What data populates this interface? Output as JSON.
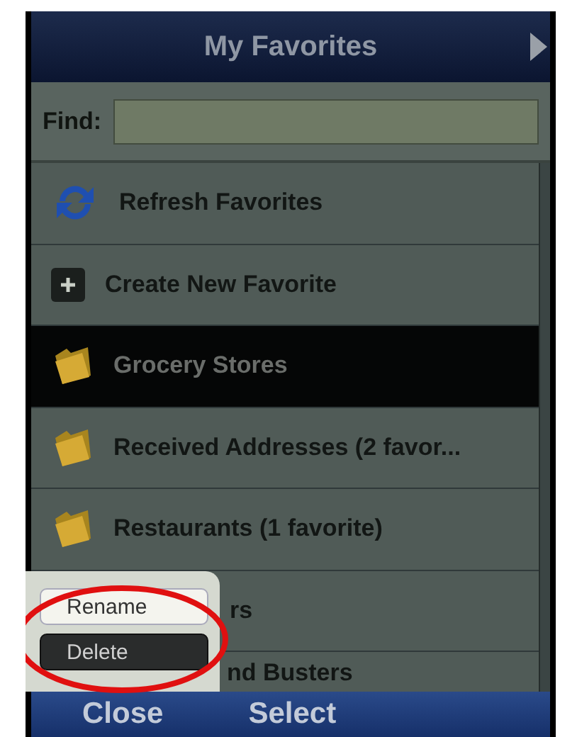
{
  "window": {
    "title": "My Favorites"
  },
  "find": {
    "label": "Find:"
  },
  "list": [
    {
      "kind": "refresh",
      "label": "Refresh Favorites",
      "selected": false
    },
    {
      "kind": "create",
      "label": "Create New Favorite",
      "selected": false
    },
    {
      "kind": "folder",
      "label": "Grocery Stores",
      "selected": true
    },
    {
      "kind": "folder",
      "label": "Received Addresses (2 favor...",
      "selected": false
    },
    {
      "kind": "folder",
      "label": "Restaurants (1 favorite)",
      "selected": false
    },
    {
      "kind": "covered",
      "label": "rs",
      "selected": false
    },
    {
      "kind": "covered",
      "label": "nd Busters",
      "selected": false
    }
  ],
  "popup_menu": [
    {
      "label": "Rename",
      "selected": false
    },
    {
      "label": "Delete",
      "selected": true
    }
  ],
  "softkeys": [
    "Close",
    "Select"
  ]
}
